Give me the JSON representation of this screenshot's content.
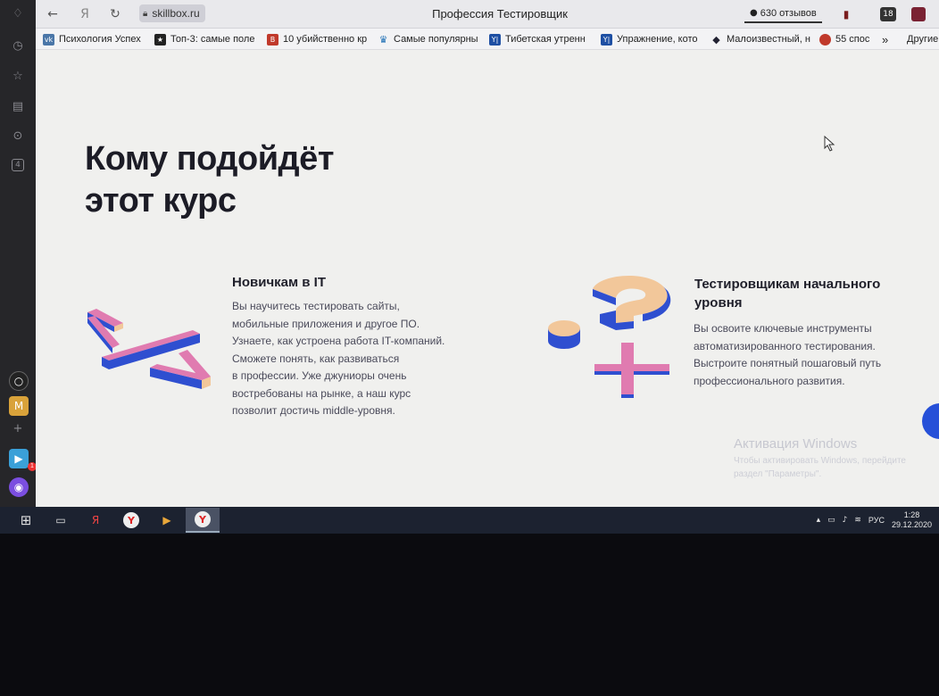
{
  "browser": {
    "address": "skillbox.ru",
    "page_title": "Профессия Тестировщик",
    "reviews": "630 отзывов",
    "tab_count": "18",
    "nav": {
      "back": "←",
      "yandex": "Я",
      "reload": "↻"
    }
  },
  "bookmarks": [
    {
      "label": "Психология Успех",
      "icon": "vk-icon",
      "color": "#4a76a8",
      "glyph": "vk"
    },
    {
      "label": "Топ-3: самые поле",
      "icon": "star-icon",
      "color": "#222222",
      "glyph": "★"
    },
    {
      "label": "10 убийственно кр",
      "icon": "b-icon",
      "color": "#c0392b",
      "glyph": "B"
    },
    {
      "label": "Самые популярны",
      "icon": "crown-icon",
      "color": "#1e6fb5",
      "glyph": "♛"
    },
    {
      "label": "Тибетская утренн",
      "icon": "yt-icon",
      "color": "#1e4fa3",
      "glyph": "Y|"
    },
    {
      "label": "Упражнение, кото",
      "icon": "yt-icon",
      "color": "#1e4fa3",
      "glyph": "Y|"
    },
    {
      "label": "Малоизвестный, н",
      "icon": "hat-icon",
      "color": "#223",
      "glyph": "◆"
    },
    {
      "label": "55 спос",
      "icon": "red-dot-icon",
      "color": "#c0392b",
      "glyph": "●"
    }
  ],
  "bookmarks_more": "»",
  "bookmarks_other": "Другие",
  "page": {
    "heading_line1": "Кому подойдёт",
    "heading_line2": "этот курс",
    "card1_title": "Новичкам в IT",
    "card1_text": [
      "Вы научитесь тестировать сайты,",
      "мобильные приложения и другое ПО.",
      "Узнаете, как устроена работа IT-компаний.",
      "Сможете понять, как развиваться",
      "в профессии. Уже джуниоры очень",
      "востребованы на рынке, а наш курс",
      "позволит достичь middle-уровня."
    ],
    "card2_title": [
      "Тестировщикам начального",
      "уровня"
    ],
    "card2_text": [
      "Вы освоите ключевые инструменты",
      "автоматизированного тестирования.",
      "Выстроите понятный пошаговый путь",
      "профессионального развития."
    ]
  },
  "windows_activation": {
    "title": "Активация Windows",
    "line1": "Чтобы активировать Windows, перейдите",
    "line2": "раздел \"Параметры\"."
  },
  "sidebar": {
    "icons": [
      "bell-icon",
      "history-icon",
      "star-icon",
      "notes-icon",
      "downloads-icon",
      "tabs-icon"
    ],
    "tabs_badge": "4",
    "apps_badge": "1"
  },
  "taskbar": {
    "language": "РУС",
    "time": "1:28",
    "date": "29.12.2020"
  },
  "colors": {
    "accent_blue": "#2650d8",
    "pink": "#e07bb0",
    "peach": "#f2c79a"
  }
}
